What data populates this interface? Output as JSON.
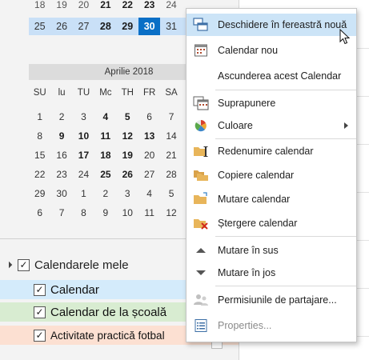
{
  "mini_calendar": {
    "top_row": [
      "18",
      "19",
      "20",
      "21",
      "22",
      "23",
      "24"
    ],
    "selected_week": [
      "25",
      "26",
      "27",
      "28",
      "29",
      "30",
      "31"
    ],
    "month_title": "Aprilie 2018",
    "weekdays": [
      "SU",
      "lu",
      "",
      "TU",
      "Mc",
      "TH",
      "FR",
      "SA"
    ],
    "weeks": [
      [
        "1",
        "2",
        "3",
        "4",
        "5",
        "6",
        "7"
      ],
      [
        "8",
        "9",
        "10",
        "11",
        "12",
        "13",
        "14"
      ],
      [
        "15",
        "16",
        "17",
        "18",
        "19",
        "20",
        "21"
      ],
      [
        "22",
        "23",
        "24",
        "25",
        "26",
        "27",
        "28"
      ],
      [
        "29",
        "30",
        "1",
        "2",
        "3",
        "4",
        "5"
      ],
      [
        "6",
        "7",
        "8",
        "9",
        "10",
        "11",
        "12"
      ]
    ]
  },
  "calendars": {
    "group_label": "Calendarele mele",
    "items": [
      {
        "label": "Calendar"
      },
      {
        "label": "Calendar de la școală"
      },
      {
        "label": "Activitate practică fotbal"
      }
    ]
  },
  "menu": {
    "open_new_window": "Deschidere în fereastră nouă",
    "new_calendar": "Calendar nou",
    "hide_calendar": "Ascunderea acest Calendar",
    "overlay": "Suprapunere",
    "color": "Culoare",
    "rename": "Redenumire calendar",
    "copy": "Copiere calendar",
    "move": "Mutare calendar",
    "delete": "Ștergere calendar",
    "move_up": "Mutare în sus",
    "move_down": "Mutare în jos",
    "sharing": "Permisiunile de partajare...",
    "properties": "Properties..."
  },
  "colors": {
    "accent": "#0a6fc6",
    "highlight": "#cce4f7",
    "calendar_blue": "#d4ebfb",
    "calendar_green": "#d8ecd1",
    "calendar_orange": "#fce0d2"
  }
}
